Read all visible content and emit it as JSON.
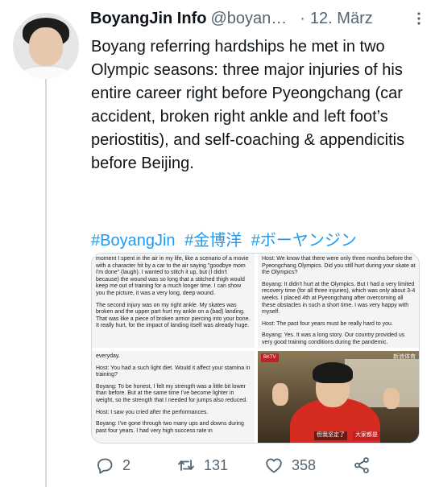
{
  "tweet": {
    "author_name": "BoyangJin Info",
    "author_handle": "@boyan…",
    "separator": "·",
    "date": "12. März",
    "text": "Boyang referring hardships he met in two Olympic seasons: three major injuries of his entire career right before Pyeongchang (car accident, broken right ankle and left foot’s periostitis), and self-coaching & appendicitis before Beijing.",
    "hashtags": [
      "#BoyangJin",
      "#金博洋",
      "#ボーヤンジン"
    ]
  },
  "media": {
    "panel_a": [
      "moment I spent in the air in my life, like a scenario of a movie with a character hit by a car to the air saying \"goodbye mom I'm done\" (laugh). I wanted to stitch it up, but (I didn't because) the wound was so long that a stitched thigh would keep me out of training for a much longer time. I can show you the picture, it was a very long, deep wound.",
      "The second injury was on my right ankle. My skates was broken and the upper part hurt my ankle on a (bad) landing. That was like a piece of broken armor piercing into your bone. It really hurt, for the impact of landing itself was already huge."
    ],
    "panel_b": [
      "Host: We know that there were only three months before the Pyeongchang Olympics. Did you still hurt during your skate at the Olympics?",
      "Boyang: It didn't hurt at the Olympics. But I had a very limited recovery time (for all three injuries), which was only about 3-4 weeks. I placed 4th at Pyeongchang after overcoming all these obstacles in such a short time. I was very happy with myself.",
      "Host: The past four years must be really hard to you.",
      "Boyang: Yes. It was a long story. Our country provided us very good training conditions during the pandemic."
    ],
    "panel_c": [
      "everyday.",
      "Host: You had a such light diet. Would it affect your stamina in training?",
      "Boyang: To be honest, I felt my strength was a little bit lower than before. But at the same time I've become lighter in weight, so the strength that I needed for jumps also reduced.",
      "Host: I saw you cried after the performances.",
      "Boyang: I've gone through two many ups and downs during past four years. I had very high success rate in"
    ],
    "video": {
      "tag": "BKTV",
      "logo": "新浪体育",
      "caption_left": "但我坚定了",
      "caption_right": "大家都是"
    }
  },
  "actions": {
    "reply_count": "2",
    "retweet_count": "131",
    "like_count": "358"
  },
  "icons": {
    "reply": "speech-bubble-icon",
    "retweet": "retweet-icon",
    "like": "heart-icon",
    "share": "share-icon",
    "more": "more-vertical-icon"
  },
  "colors": {
    "link": "#1d9bf0",
    "secondary_text": "#536471",
    "primary_text": "#0f1419"
  }
}
